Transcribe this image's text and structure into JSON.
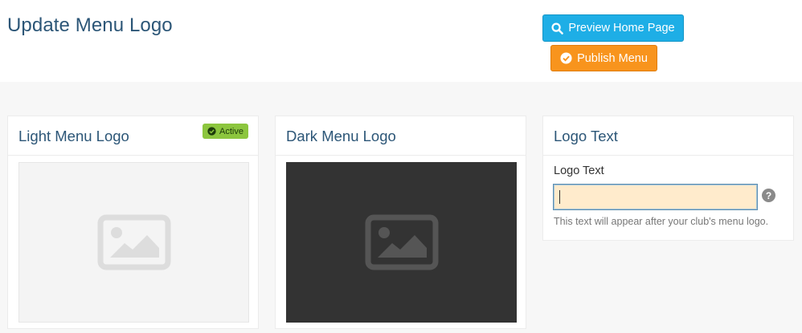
{
  "header": {
    "title": "Update Menu Logo",
    "preview_button": {
      "label": "Preview Home Page",
      "icon": "search-icon",
      "color": "#1eaee6"
    },
    "publish_button": {
      "label": "Publish Menu",
      "icon": "check-circle-icon",
      "color": "#f8941d"
    }
  },
  "cards": {
    "light_logo": {
      "title": "Light Menu Logo",
      "badge": {
        "label": "Active",
        "icon": "check-circle-icon",
        "color": "#8cc63e"
      },
      "image_placeholder_icon": "image-icon",
      "background": "#f4f4f4"
    },
    "dark_logo": {
      "title": "Dark Menu Logo",
      "image_placeholder_icon": "image-icon",
      "background": "#333333"
    },
    "logo_text": {
      "title": "Logo Text",
      "field_label": "Logo Text",
      "field_value": "",
      "field_placeholder": "",
      "help_icon": "question-circle-icon",
      "help_text": "This text will appear after your club's menu logo."
    }
  },
  "colors": {
    "title": "#2c5677",
    "page_background": "#f7f7f7"
  }
}
